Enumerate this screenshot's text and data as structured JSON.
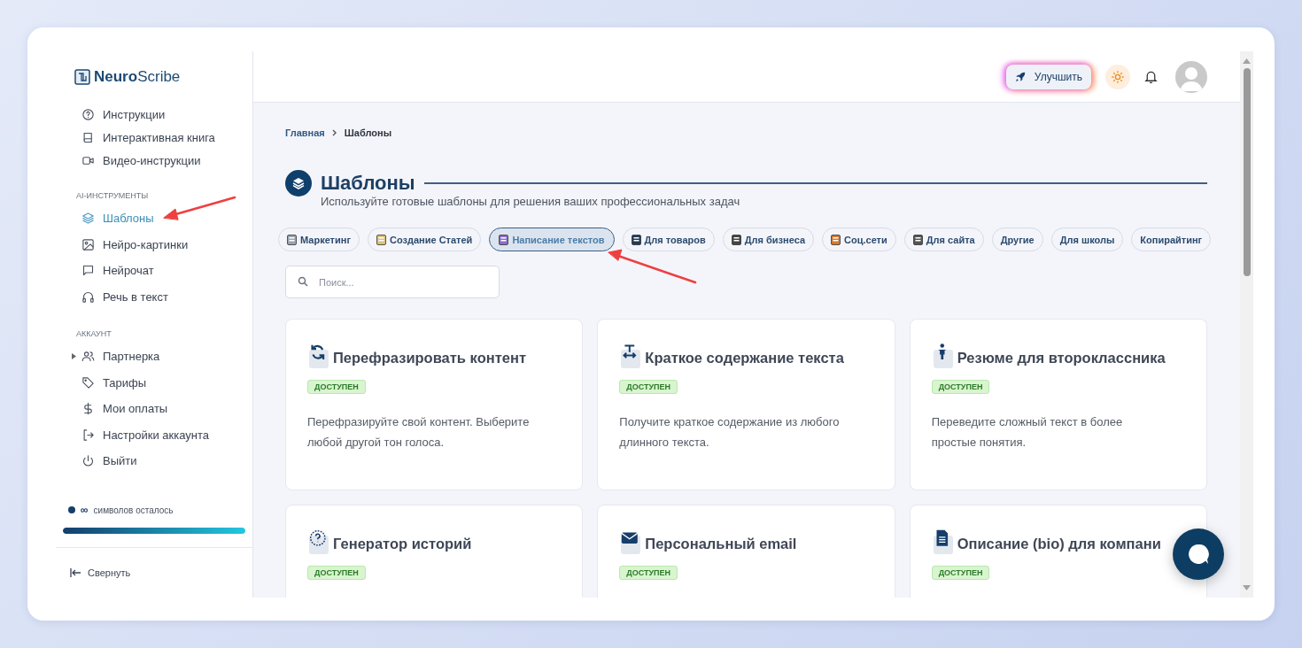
{
  "header": {
    "logo": "**Neuro**Scribe",
    "upgrade_button": "Улучшить"
  },
  "sidebar": {
    "sections": [
      {
        "items": [
          {
            "label": "Инструкции",
            "selected": false,
            "expandable": false
          },
          {
            "label": "Интерактивная книга",
            "selected": false,
            "expandable": false
          },
          {
            "label": "Видео-инструкции",
            "selected": false,
            "expandable": false
          }
        ]
      },
      {
        "label": "AI-ИНСТРУМЕНТЫ",
        "items": [
          {
            "label": "Шаблоны",
            "selected": true,
            "expandable": false
          },
          {
            "label": "Нейро-картинки",
            "selected": false,
            "expandable": false
          },
          {
            "label": "Нейрочат",
            "selected": false,
            "expandable": false
          },
          {
            "label": "Речь в текст",
            "selected": false,
            "expandable": false
          }
        ]
      },
      {
        "label": "АККАУНТ",
        "items": [
          {
            "label": "Партнерка",
            "selected": false,
            "expandable": true
          },
          {
            "label": "Тарифы",
            "selected": false,
            "expandable": false
          },
          {
            "label": "Мои оплаты",
            "selected": false,
            "expandable": false
          },
          {
            "label": "Настройки аккаунта",
            "selected": false,
            "expandable": false
          },
          {
            "label": "Выйти",
            "selected": false,
            "expandable": false
          }
        ]
      }
    ],
    "usage": {
      "symbol": "∞",
      "label": "символов осталось",
      "level": 1
    },
    "collapse_button": "Свернуть"
  },
  "breadcrumb": [
    {
      "label": "Главная"
    },
    {
      "label": "Шаблоны"
    }
  ],
  "page": {
    "title": "Шаблоны",
    "subtitle": "Используйте готовые шаблоны для решения ваших профессиональных задач"
  },
  "filters": [
    {
      "label": "Маркетинг",
      "selected": false
    },
    {
      "label": "Создание Статей",
      "selected": false
    },
    {
      "label": "Написание текстов",
      "selected": true
    },
    {
      "label": "Для товаров",
      "selected": false
    },
    {
      "label": "Для бизнеса",
      "selected": false
    },
    {
      "label": "Соц.сети",
      "selected": false
    },
    {
      "label": "Для сайта",
      "selected": false
    },
    {
      "label": "Другие",
      "selected": false
    },
    {
      "label": "Для школы",
      "selected": false
    },
    {
      "label": "Копирайтинг",
      "selected": false
    }
  ],
  "search": {
    "placeholder": "Поиск..."
  },
  "cards": [
    {
      "title": "Перефразировать контент",
      "badge": "ДОСТУПЕН",
      "description": "Перефразируйте свой контент. Выберите любой другой тон голоса."
    },
    {
      "title": "Краткое содержание текста",
      "badge": "ДОСТУПЕН",
      "description": "Получите краткое содержание из любого длинного текста."
    },
    {
      "title": "Резюме для второклассника",
      "badge": "ДОСТУПЕН",
      "description": "Переведите сложный текст в более простые понятия."
    },
    {
      "title": "Генератор историй",
      "badge": "ДОСТУПЕН"
    },
    {
      "title": "Персональный email",
      "badge": "ДОСТУПЕН"
    },
    {
      "title": "Описание (bio) для компани",
      "badge": "ДОСТУПЕН"
    }
  ]
}
